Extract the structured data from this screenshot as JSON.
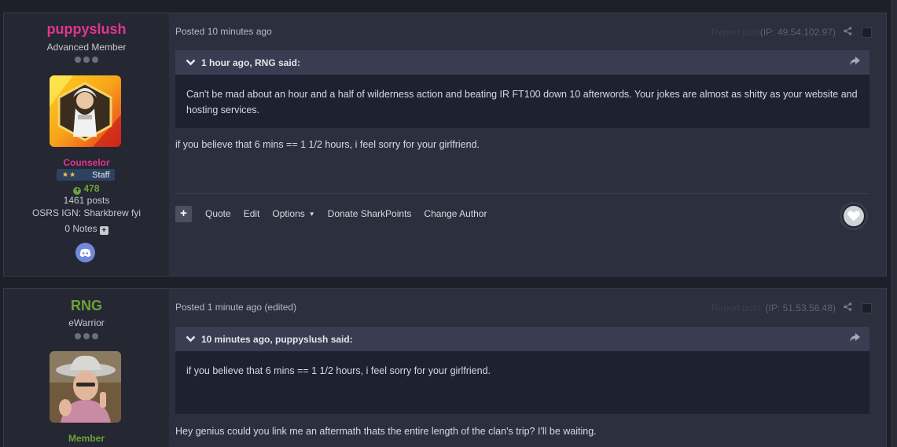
{
  "posts": [
    {
      "author": {
        "name": "puppyslush",
        "title": "Advanced Member",
        "group": "Counselor",
        "badge": {
          "stars": "★★",
          "label": "Staff"
        },
        "reputation": "478",
        "post_count": "1461 posts",
        "ign": "OSRS IGN: Sharkbrew fyi",
        "notes": "0 Notes",
        "avatar_icon": "avatar-image"
      },
      "meta": "Posted 10 minutes ago",
      "report": "Report post",
      "ip": "(IP: 49.54.102.97)",
      "quote": {
        "header": "1 hour ago, RNG said:",
        "body": "Can't be mad about an hour and a half of wilderness action and beating IR FT100 down 10 afterwords. Your jokes are almost as shitty as your website and hosting services."
      },
      "text": "if you believe that 6 mins == 1  1/2 hours, i feel sorry for your girlfriend.",
      "actions": {
        "quote": "Quote",
        "edit": "Edit",
        "options": "Options",
        "donate": "Donate SharkPoints",
        "change_author": "Change Author"
      }
    },
    {
      "author": {
        "name": "RNG",
        "title": "eWarrior",
        "group": "Member",
        "avatar_icon": "avatar-image"
      },
      "meta": "Posted 1 minute ago (edited)",
      "report": "Report post",
      "ip": "(IP: 51.53.56.48)",
      "quote": {
        "header": "10 minutes ago, puppyslush said:",
        "body": "if you believe that 6 mins == 1  1/2 hours, i feel sorry for your girlfriend."
      },
      "text": "Hey genius could you link me an aftermath thats the entire length of the clan's trip? I'll be waiting."
    }
  ],
  "colors": {
    "background": "#1e2029",
    "post_bg": "#2c2f3d",
    "author_bg": "#252733",
    "counselor": "#e0368f",
    "member": "#6ea238",
    "quote_head": "#3a3d51",
    "quote_body": "#1d2130",
    "discord": "#7289da"
  }
}
